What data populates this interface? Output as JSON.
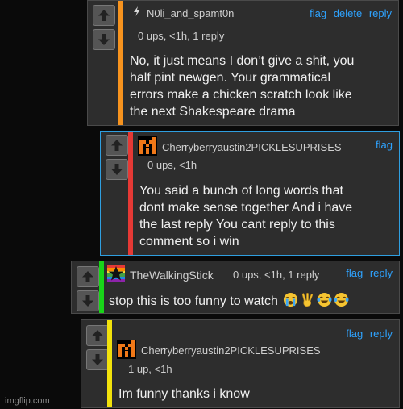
{
  "comments": [
    {
      "username": "N0li_and_spamt0n",
      "meta": "0 ups, <1h, 1 reply",
      "actions": [
        "flag",
        "delete",
        "reply"
      ],
      "text": "No, it just means I don’t give a shit, you\nhalf pint newgen. Your grammatical\nerrors make a chicken scratch look like\nthe next Shakespeare drama",
      "bar_color": "#f7931e",
      "avatar_icon": "lightning-avatar-icon"
    },
    {
      "username": "Cherryberryaustin2PICKLESUPRISES",
      "meta": "0 ups, <1h",
      "actions": [
        "flag"
      ],
      "text": "You said a bunch of long words that\ndont make sense together And i have\nthe last reply You cant reply to this\ncomment so i win",
      "bar_color": "#e53935",
      "avatar_icon": "orange-pixel-avatar-icon"
    },
    {
      "username": "TheWalkingStick",
      "meta": "0 ups, <1h, 1 reply",
      "actions": [
        "flag",
        "reply"
      ],
      "text": "stop this is too funny to watch",
      "emojis": [
        "loudly-crying-face-emoji",
        "victory-hand-emoji",
        "tears-of-joy-emoji",
        "tears-of-joy-emoji"
      ],
      "bar_color": "#19d419",
      "avatar_icon": "rainbow-star-avatar-icon"
    },
    {
      "username": "Cherryberryaustin2PICKLESUPRISES",
      "meta": "1 up, <1h",
      "actions": [
        "flag",
        "reply"
      ],
      "text": "Im funny thanks i know",
      "bar_color": "#f2e20c",
      "avatar_icon": "orange-pixel-avatar-icon"
    }
  ],
  "colors": {
    "link": "#2ea3ff",
    "highlight_border": "#2f9fe0"
  },
  "watermark": "imgflip.com"
}
